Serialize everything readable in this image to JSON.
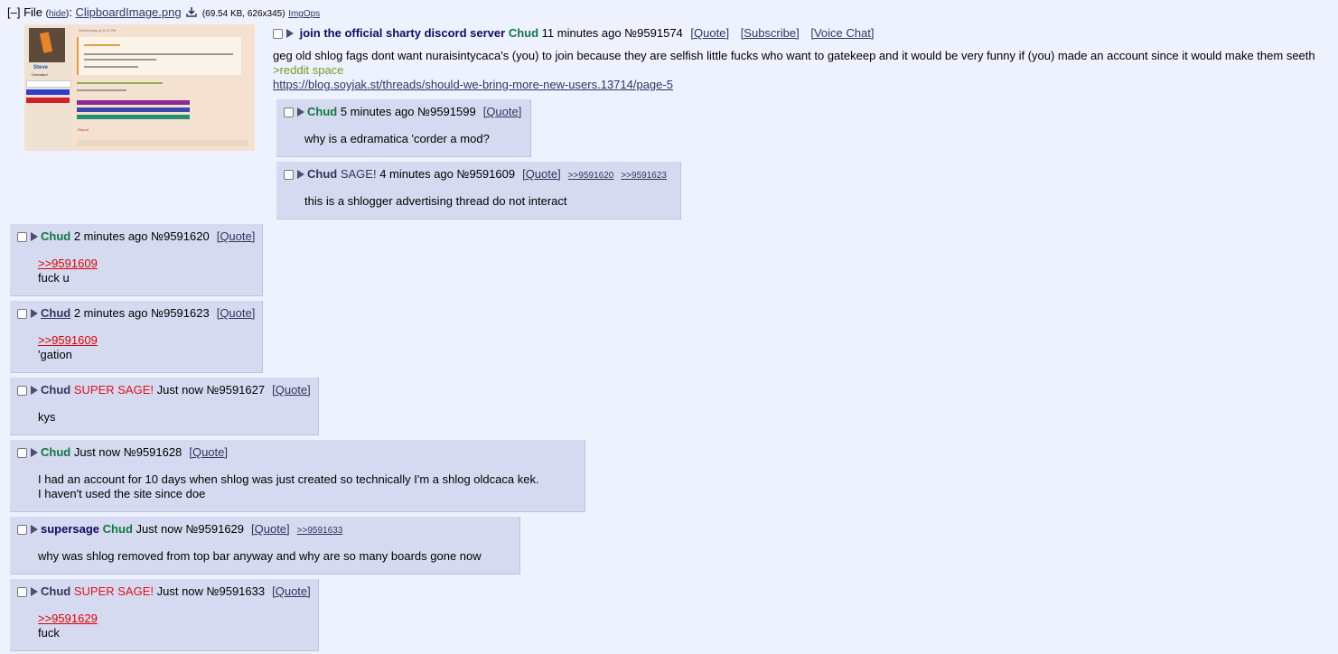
{
  "file": {
    "toggle": "[–]",
    "label": "File",
    "hide": "hide",
    "filename": "ClipboardImage.png",
    "info": "(69.54 KB, 626x345)",
    "imgops": "ImgOps"
  },
  "thumbnail_text": {
    "date": "Wednesday at 8:11 PM",
    "username": "Steve",
    "title": "Dramaturt",
    "quote_line": "I was talking to some nu /qa/ fag about bringing new users to the shlog",
    "green": ">bringing nu/qa/fags to the shlog",
    "reply": "stop stop just stop",
    "report": "Report",
    "footer": "1844 in Something, XXX_SKIBIDISIGMA_XXX, Donald McDonald and 2 others"
  },
  "op": {
    "subject": "join the official sharty discord server",
    "name": "Chud",
    "time": "11 minutes ago",
    "no": "№9591574",
    "quote": "[Quote]",
    "subscribe": "[Subscribe]",
    "voice": "[Voice Chat]",
    "line1": "geg old shlog fags dont want nuraisintycaca's (you) to join because they are selfish little fucks who want to gatekeep and it would be very funny if (you) made an account since it would make them seeth",
    "line2": ">reddit space",
    "line3": "https://blog.soyjak.st/threads/should-we-bring-more-new-users.13714/page-5"
  },
  "posts": [
    {
      "name": "Chud",
      "sage": "",
      "time": "5 minutes ago",
      "no": "№9591599",
      "quote": "[Quote]",
      "backlinks": [],
      "lines": [
        "why is a edramatica 'corder a mod?"
      ]
    },
    {
      "name": "Chud",
      "sage": "SAGE!",
      "time": "4 minutes ago",
      "no": "№9591609",
      "quote": "[Quote]",
      "backlinks": [
        ">>9591620",
        ">>9591623"
      ],
      "lines": [
        "this is a shlogger advertising thread do not interact"
      ]
    },
    {
      "name": "Chud",
      "sage": "",
      "time": "2 minutes ago",
      "no": "№9591620",
      "quote": "[Quote]",
      "backlinks": [],
      "reply": ">>9591609",
      "lines": [
        "fuck u"
      ]
    },
    {
      "name": "Chud",
      "sage": "",
      "time": "2 minutes ago",
      "no": "№9591623",
      "quote": "[Quote]",
      "backlinks": [],
      "reply": ">>9591609",
      "lines": [
        "'gation"
      ]
    },
    {
      "name": "Chud",
      "sage": "SUPER SAGE!",
      "time": "Just now",
      "no": "№9591627",
      "quote": "[Quote]",
      "backlinks": [],
      "lines": [
        "kys"
      ]
    },
    {
      "name": "Chud",
      "sage": "",
      "time": "Just now",
      "no": "№9591628",
      "quote": "[Quote]",
      "backlinks": [],
      "lines": [
        "I had an account for 10 days when shlog was just created so technically I'm a shlog oldcaca kek.",
        "I haven't used the site since doe"
      ]
    },
    {
      "subject": "supersage",
      "name": "Chud",
      "sage": "",
      "time": "Just now",
      "no": "№9591629",
      "quote": "[Quote]",
      "backlinks": [
        ">>9591633"
      ],
      "lines": [
        "why was shlog removed from top bar anyway and why are so many boards gone now"
      ]
    },
    {
      "name": "Chud",
      "sage": "SUPER SAGE!",
      "time": "Just now",
      "no": "№9591633",
      "quote": "[Quote]",
      "backlinks": [],
      "reply": ">>9591629",
      "lines": [
        "fuck"
      ]
    }
  ],
  "colors": {
    "background": "#eef2ff",
    "post_bg": "#d6daf0",
    "name_green": "#117743",
    "subject_blue": "#0f0c5d",
    "supersage_red": "#e0101a",
    "quotelink_red": "#dd0000",
    "greentext": "#789922"
  }
}
